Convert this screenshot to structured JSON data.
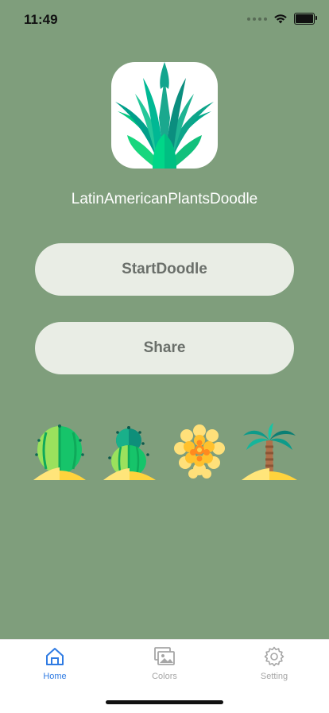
{
  "status_bar": {
    "time": "11:49"
  },
  "app": {
    "title": "LatinAmericanPlantsDoodle"
  },
  "buttons": {
    "start_label": "StartDoodle",
    "share_label": "Share"
  },
  "tabs": [
    {
      "label": "Home",
      "icon": "home-icon",
      "active": true,
      "color": "#2f7be3"
    },
    {
      "label": "Colors",
      "icon": "photos-icon",
      "active": false,
      "color": "#a6a6a6"
    },
    {
      "label": "Setting",
      "icon": "gear-icon",
      "active": false,
      "color": "#a6a6a6"
    }
  ],
  "decor_icons": [
    "round-cactus-icon",
    "stacked-cactus-icon",
    "yellow-flower-icon",
    "palm-tree-icon"
  ],
  "colors": {
    "background": "#7f9e7c",
    "button_bg": "#e9ede5",
    "accent": "#2f7be3"
  }
}
